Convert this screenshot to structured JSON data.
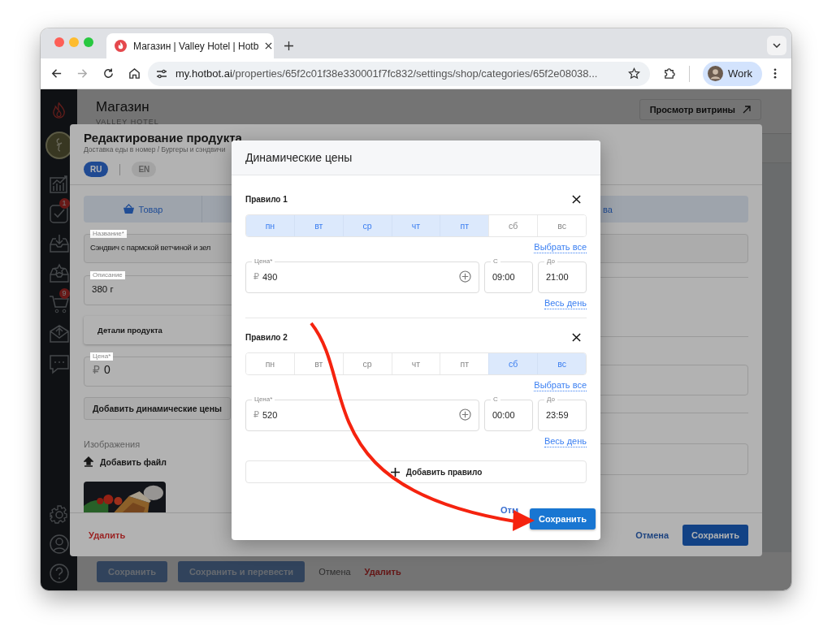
{
  "browser": {
    "tab": {
      "title": "Магазин | Valley Hotel | Hotb"
    },
    "url": {
      "host": "my.hotbot.ai",
      "path": "/properties/65f2c01f38e330001f7fc832/settings/shop/categories/65f2e08038..."
    },
    "profile": {
      "label": "Work"
    }
  },
  "sidebar": {
    "badges": [
      {
        "text": "1"
      },
      {
        "text": "9"
      }
    ]
  },
  "page": {
    "title": "Магазин",
    "subtitle": "VALLEY HOTEL",
    "storefront_button": "Просмотр витрины",
    "footer_buttons": [
      {
        "label": "Сохранить",
        "kind": "primary"
      },
      {
        "label": "Сохранить и перевести",
        "kind": "primary"
      },
      {
        "label": "Отмена",
        "kind": "link"
      },
      {
        "label": "Удалить",
        "kind": "danger"
      }
    ]
  },
  "product_modal": {
    "title": "Редактирование продукта",
    "breadcrumb": "Доставка еды в номер / Бургеры и сэндвичи",
    "languages": [
      {
        "label": "RU",
        "selected": true
      },
      {
        "label": "EN",
        "selected": false
      }
    ],
    "tabs": [
      {
        "label": "Товар"
      },
      {
        "label": "ва"
      }
    ],
    "name_field": {
      "label": "Название*",
      "value": "Сэндвич с пармской ветчиной и зел"
    },
    "description_field": {
      "label": "Описание",
      "value": "380 г"
    },
    "details_section": "Детали продукта",
    "price_field": {
      "label": "Цена*",
      "currency": "₽",
      "value": "0"
    },
    "dynamic_button": "Добавить динамические цены",
    "images_label": "Изображения",
    "add_file": "Добавить файл",
    "delete": "Удалить",
    "cancel": "Отмена",
    "save": "Сохранить"
  },
  "dynamic_prices": {
    "title": "Динамические цены",
    "rules": [
      {
        "title": "Правило 1",
        "days": [
          {
            "label": "пн",
            "selected": true
          },
          {
            "label": "вт",
            "selected": true
          },
          {
            "label": "ср",
            "selected": true
          },
          {
            "label": "чт",
            "selected": true
          },
          {
            "label": "пт",
            "selected": true
          },
          {
            "label": "сб",
            "selected": false
          },
          {
            "label": "вс",
            "selected": false
          }
        ],
        "select_all": "Выбрать все",
        "price": {
          "label": "Цена*",
          "currency": "₽",
          "value": "490"
        },
        "from": {
          "label": "С",
          "value": "09:00"
        },
        "to": {
          "label": "До",
          "value": "21:00"
        },
        "all_day": "Весь день"
      },
      {
        "title": "Правило 2",
        "days": [
          {
            "label": "пн",
            "selected": false
          },
          {
            "label": "вт",
            "selected": false
          },
          {
            "label": "ср",
            "selected": false
          },
          {
            "label": "чт",
            "selected": false
          },
          {
            "label": "пт",
            "selected": false
          },
          {
            "label": "сб",
            "selected": true
          },
          {
            "label": "вс",
            "selected": true
          }
        ],
        "select_all": "Выбрать все",
        "price": {
          "label": "Цена*",
          "currency": "₽",
          "value": "520"
        },
        "from": {
          "label": "С",
          "value": "00:00"
        },
        "to": {
          "label": "До",
          "value": "23:59"
        },
        "all_day": "Весь день"
      }
    ],
    "add_rule": "Добавить правило",
    "cancel": "Отм",
    "save": "Сохранить"
  }
}
